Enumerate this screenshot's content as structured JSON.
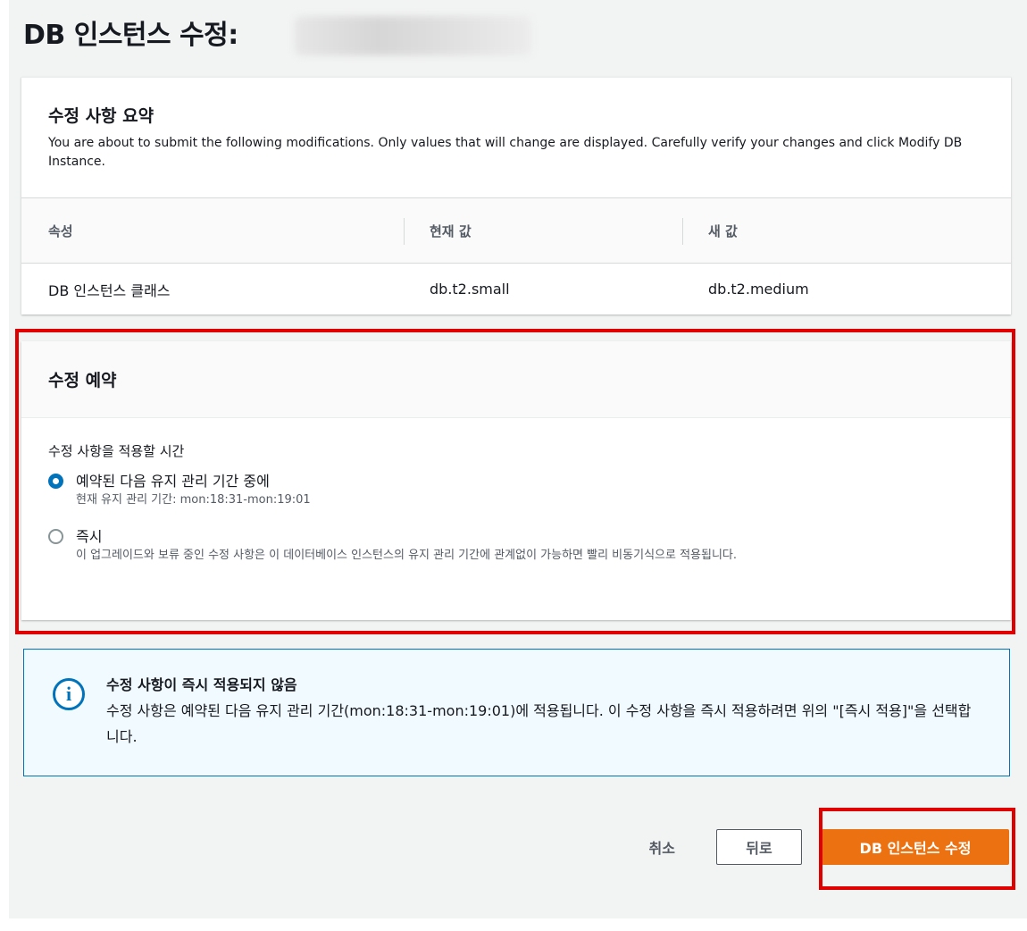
{
  "page": {
    "title": "DB 인스턴스 수정:"
  },
  "summary": {
    "title": "수정 사항 요약",
    "description": "You are about to submit the following modifications. Only values that will change are displayed. Carefully verify your changes and click Modify DB Instance.",
    "columns": [
      "속성",
      "현재 값",
      "새 값"
    ],
    "rows": [
      {
        "attribute": "DB 인스턴스 클래스",
        "current": "db.t2.small",
        "new": "db.t2.medium"
      }
    ]
  },
  "schedule": {
    "title": "수정 예약",
    "field_label": "수정 사항을 적용할 시간",
    "options": [
      {
        "label": "예약된 다음 유지 관리 기간 중에",
        "description": "현재 유지 관리 기간: mon:18:31-mon:19:01",
        "selected": true
      },
      {
        "label": "즉시",
        "description": "이 업그레이드와 보류 중인 수정 사항은 이 데이터베이스 인스턴스의 유지 관리 기간에 관계없이 가능하면 빨리 비동기식으로 적용됩니다.",
        "selected": false
      }
    ]
  },
  "alert": {
    "icon": "info-icon",
    "title": "수정 사항이 즉시 적용되지 않음",
    "body": "수정 사항은 예약된 다음 유지 관리 기간(mon:18:31-mon:19:01)에 적용됩니다. 이 수정 사항을 즉시 적용하려면 위의 \"[즉시 적용]\"을 선택합니다."
  },
  "actions": {
    "cancel_label": "취소",
    "back_label": "뒤로",
    "submit_label": "DB 인스턴스 수정"
  },
  "colors": {
    "primary_button": "#ec7211",
    "info_accent": "#0073bb",
    "highlight": "#e00000"
  }
}
